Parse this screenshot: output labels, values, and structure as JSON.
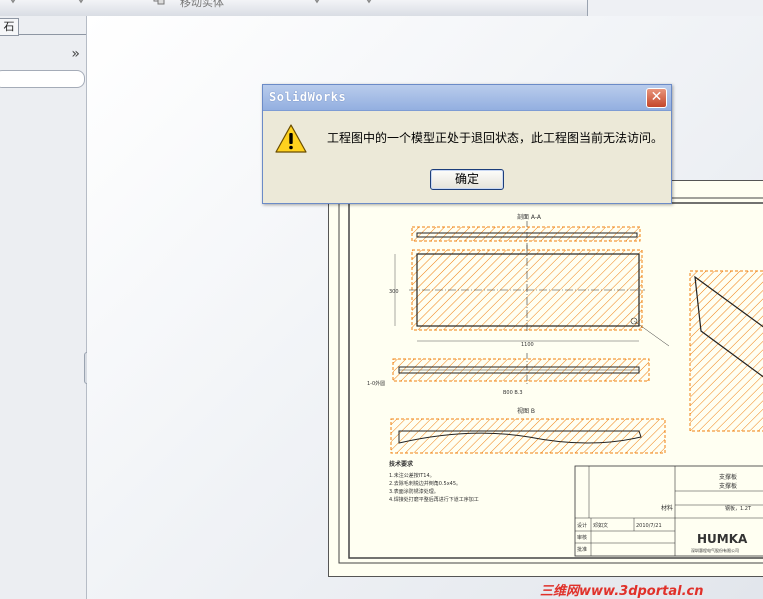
{
  "toolbar": {
    "partial_label": "移动实体"
  },
  "left_panel": {
    "tab_label": "石",
    "expand_glyph": "»",
    "collapse_glyph": "◂◂◂"
  },
  "dialog": {
    "title": "SolidWorks",
    "close_glyph": "✕",
    "message": "工程图中的一个模型正处于退回状态，此工程图当前无法访问。",
    "ok_label": "确定",
    "icon": "warning-icon"
  },
  "drawing": {
    "section_label": "剖面 A-A",
    "detail_label": "视图 B",
    "dim_width": "1100",
    "dim_height": "300",
    "dim_b": "B00 B.3",
    "note_tag": "1-0外圆",
    "tech_title": "技术要求",
    "tech_notes": [
      "1.未注公差按IT14。",
      "2.去除毛刺锐边并倒角0.5x45。",
      "3.表面涂防锈漆处理。",
      "4.焊接处打磨平整后再进行下道工序加工"
    ],
    "title_block": {
      "part_name": "支撑板",
      "part_sub": "支撑板",
      "material_label": "材料",
      "material_value": "钢板，1.2T",
      "design_label": "设计",
      "check_label": "审核",
      "approve_label": "批准",
      "designer": "邓如文",
      "date": "2010/7/21",
      "company_logo": "HUMKA",
      "company_name": "深圳惠程电气股份有限公司"
    }
  },
  "watermark": {
    "brand": "三维网",
    "url": "www.3dportal.cn"
  },
  "colors": {
    "hatch": "#f08010",
    "dialog_bg": "#ece9d8",
    "title_grad": "#93afe0",
    "close": "#c4462a"
  }
}
